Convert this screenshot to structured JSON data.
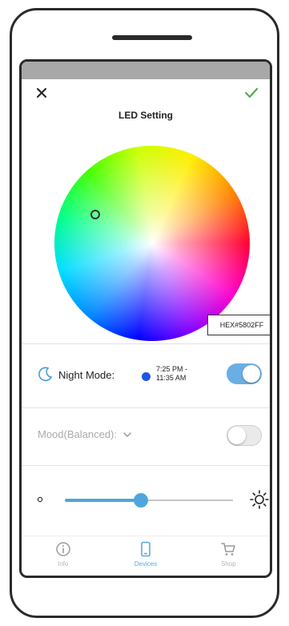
{
  "header": {
    "title": "LED Setting"
  },
  "color_picker": {
    "hex_value": "HEX#5802FF"
  },
  "night_mode": {
    "label": "Night Mode:",
    "time_range": "7:25 PM -\n11:35 AM",
    "enabled": true
  },
  "mood": {
    "label": "Mood(Balanced):",
    "enabled": false
  },
  "brightness": {
    "level": 0.45
  },
  "nav": {
    "items": [
      {
        "label": "Info",
        "icon": "info-icon",
        "active": false
      },
      {
        "label": "Devices",
        "icon": "phone-icon",
        "active": true
      },
      {
        "label": "Shop",
        "icon": "cart-icon",
        "active": false
      }
    ]
  },
  "colors": {
    "accent": "#5aa8e3",
    "toggle_on": "#6aaee4",
    "confirm": "#4caf50",
    "night_dot": "#1d55e6"
  }
}
